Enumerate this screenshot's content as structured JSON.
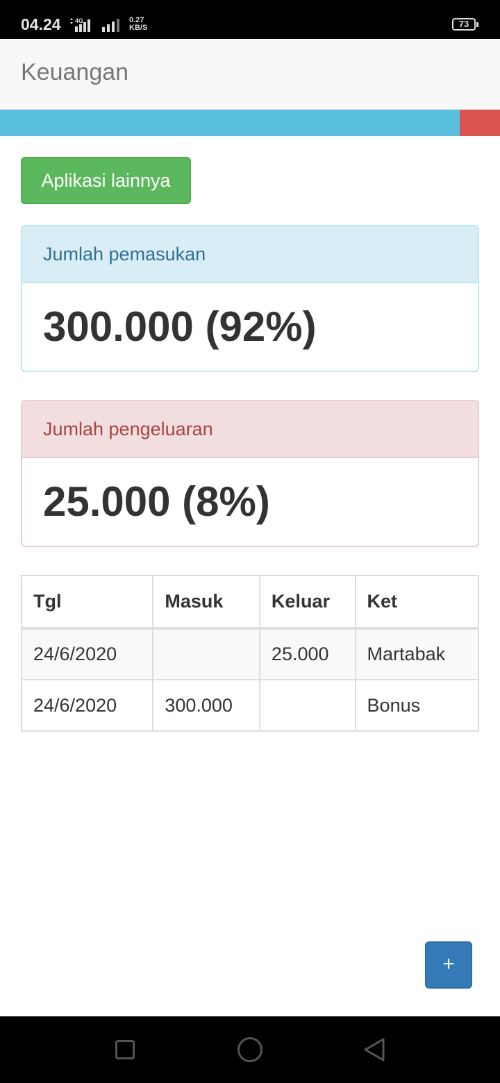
{
  "status_bar": {
    "time": "04.24",
    "network_type": "4G",
    "net_speed_value": "0.27",
    "net_speed_unit": "KB/S",
    "battery_level": "73"
  },
  "app_bar": {
    "title": "Keuangan"
  },
  "progress": {
    "income_percent": 92,
    "expense_percent": 8,
    "income_color": "#5bc0de",
    "expense_color": "#d9534f"
  },
  "apps_button": {
    "label": "Aplikasi lainnya"
  },
  "income_panel": {
    "heading": "Jumlah pemasukan",
    "value": "300.000 (92%)"
  },
  "expense_panel": {
    "heading": "Jumlah pengeluaran",
    "value": "25.000 (8%)"
  },
  "table": {
    "headers": {
      "date": "Tgl",
      "in": "Masuk",
      "out": "Keluar",
      "note": "Ket"
    },
    "rows": [
      {
        "date": "24/6/2020",
        "in": "",
        "out": "25.000",
        "note": "Martabak"
      },
      {
        "date": "24/6/2020",
        "in": "300.000",
        "out": "",
        "note": "Bonus"
      }
    ]
  },
  "fab": {
    "label": "+",
    "icon": "plus-icon"
  },
  "nav_bar": {
    "icons": [
      "recent-apps-icon",
      "home-icon",
      "back-icon"
    ]
  }
}
